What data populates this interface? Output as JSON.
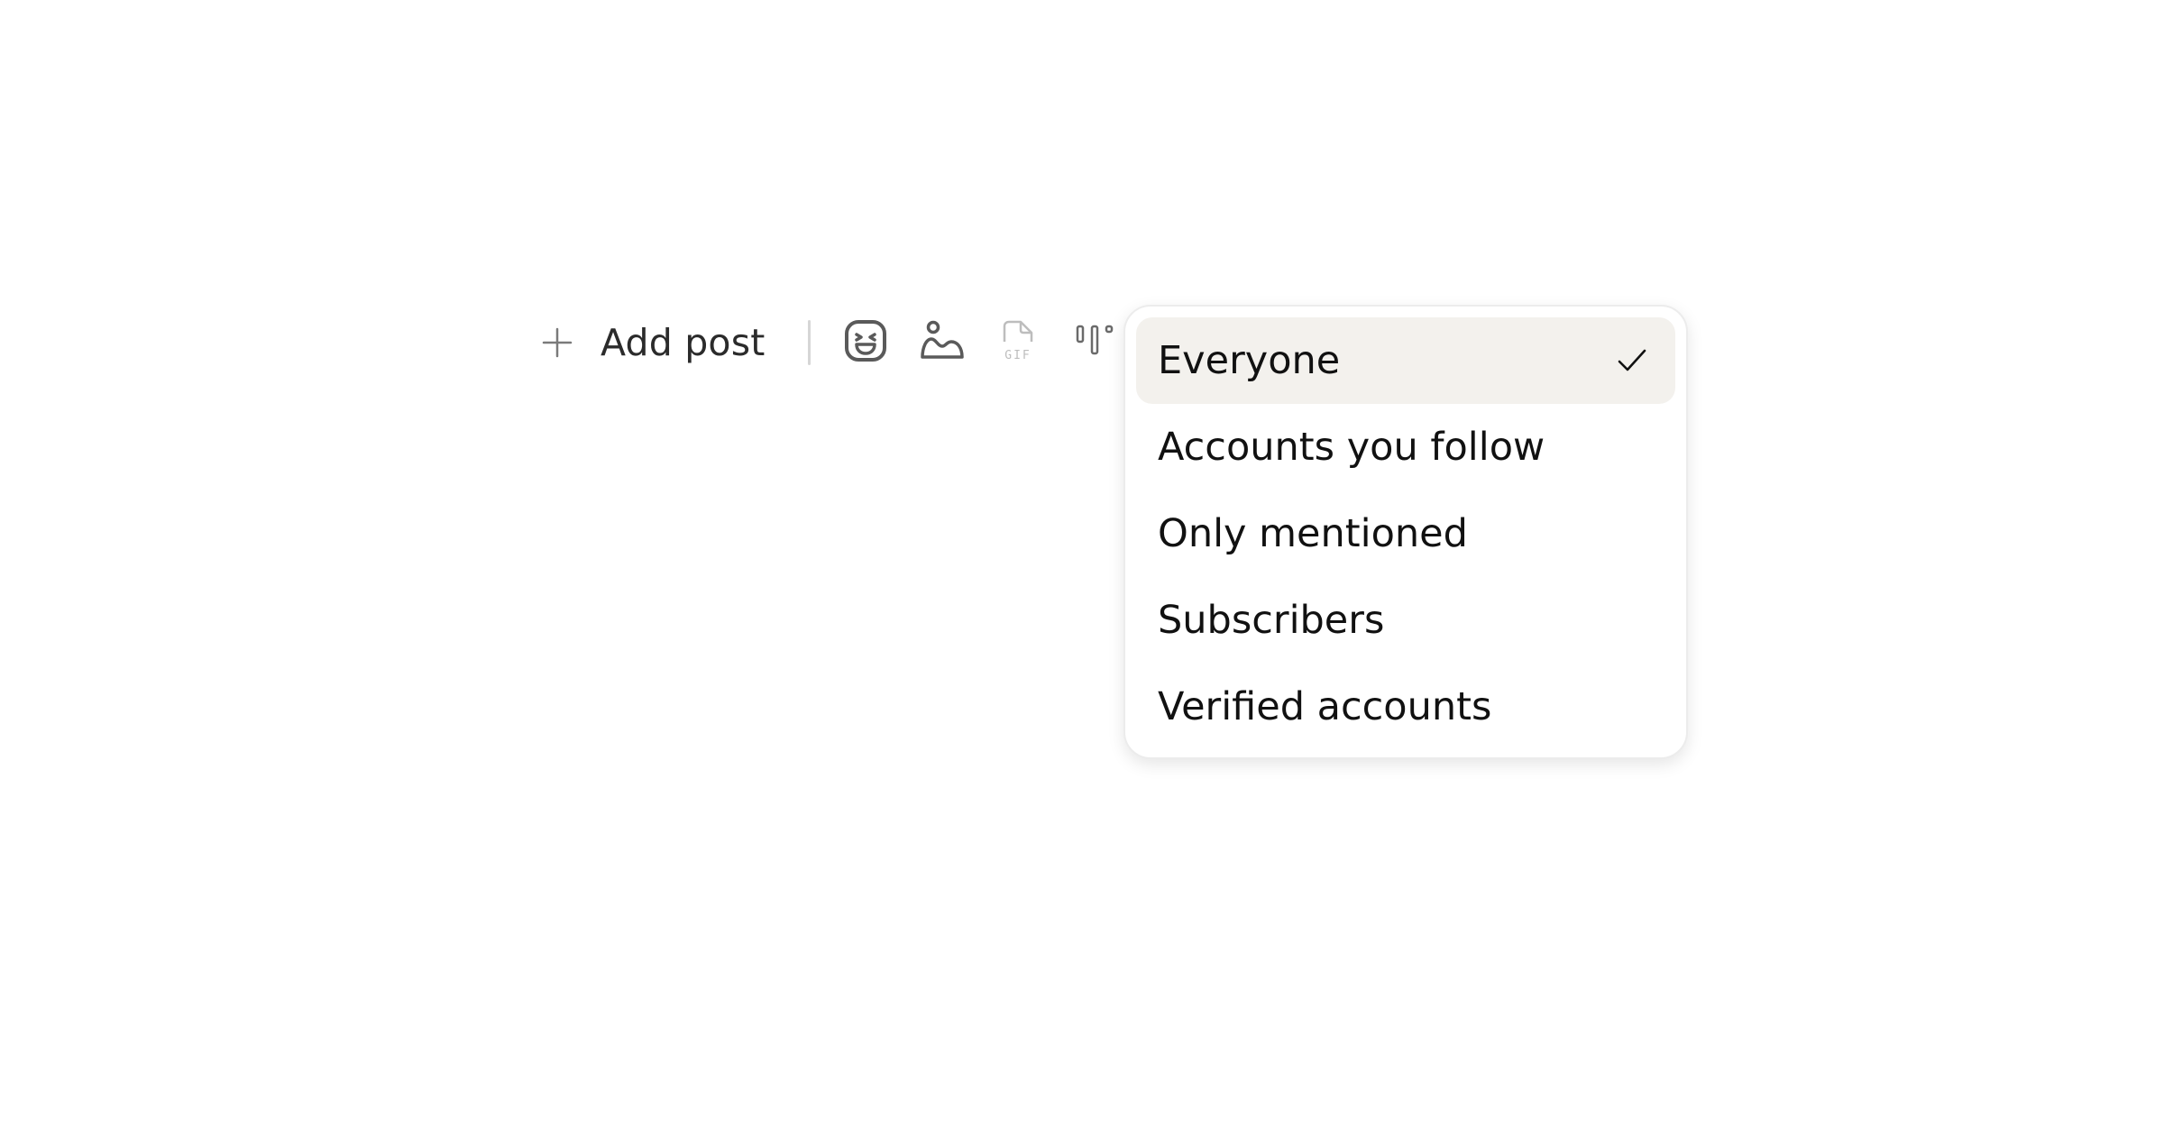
{
  "toolbar": {
    "add_post_label": "Add post",
    "icons": [
      "plus-icon",
      "sticker-icon",
      "image-icon",
      "gif-icon",
      "poll-icon"
    ],
    "gif_text": "GIF"
  },
  "reply_menu": {
    "options": [
      {
        "label": "Everyone",
        "selected": true
      },
      {
        "label": "Accounts you follow",
        "selected": false
      },
      {
        "label": "Only mentioned",
        "selected": false
      },
      {
        "label": "Subscribers",
        "selected": false
      },
      {
        "label": "Verified accounts",
        "selected": false
      }
    ]
  },
  "colors": {
    "selected_bg": "#f3f1ed",
    "icon": "#5a5a5a",
    "icon_disabled": "#bdbdbd",
    "text": "#111111"
  }
}
